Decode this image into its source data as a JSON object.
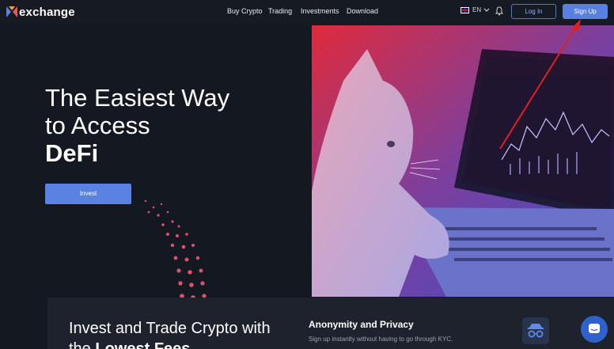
{
  "brand": {
    "name": "exchange"
  },
  "nav": {
    "links": [
      "Buy Crypto",
      "Trading",
      "Investments",
      "Download"
    ],
    "language": "EN",
    "login_label": "Log In",
    "signup_label": "Sign Up"
  },
  "hero": {
    "line1": "The Easiest Way",
    "line2": "to Access",
    "line3": "DeFi",
    "invest_label": "Invest"
  },
  "features": {
    "title_plain": "Invest and Trade Crypto with",
    "title_bold_prefix": "the ",
    "title_bold": "Lowest Fees",
    "anonymity_title": "Anonymity and Privacy",
    "anonymity_text": "Sign up instantly without having to go through KYC."
  },
  "icons": {
    "logo": "exchange-logo-icon",
    "flag": "uk-flag-icon",
    "chevron": "chevron-down-icon",
    "bell": "bell-icon",
    "anonymity": "spy-glasses-icon",
    "chat": "chat-icon"
  },
  "colors": {
    "background": "#141820",
    "accent": "#5880df",
    "annotation_arrow": "#e02020"
  }
}
